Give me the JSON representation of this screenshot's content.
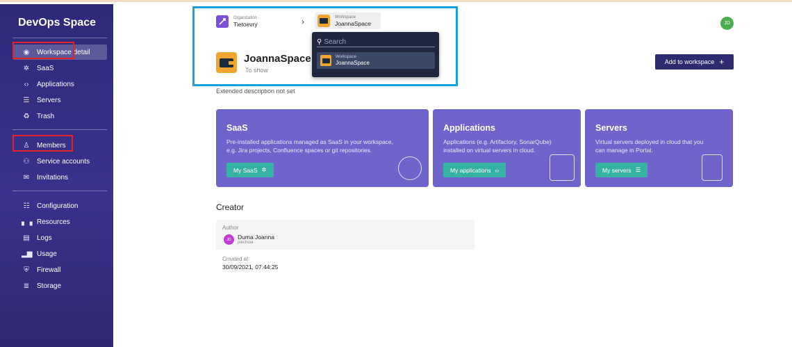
{
  "app": {
    "title": "DevOps Space"
  },
  "sidebar": {
    "items": [
      {
        "label": "Workspace detail",
        "icon": "eye-icon",
        "active": true
      },
      {
        "label": "SaaS",
        "icon": "saas-icon"
      },
      {
        "label": "Applications",
        "icon": "code-icon"
      },
      {
        "label": "Servers",
        "icon": "server-icon"
      },
      {
        "label": "Trash",
        "icon": "trash-icon"
      },
      {
        "label": "Members",
        "icon": "person-icon"
      },
      {
        "label": "Service accounts",
        "icon": "people-icon"
      },
      {
        "label": "Invitations",
        "icon": "mail-icon"
      },
      {
        "label": "Configuration",
        "icon": "sliders-icon"
      },
      {
        "label": "Resources",
        "icon": "bars-icon"
      },
      {
        "label": "Logs",
        "icon": "document-icon"
      },
      {
        "label": "Usage",
        "icon": "chart-icon"
      },
      {
        "label": "Firewall",
        "icon": "shield-icon"
      },
      {
        "label": "Storage",
        "icon": "list-icon"
      }
    ]
  },
  "breadcrumb": {
    "org_caption": "Organization",
    "org_name": "Tietoevry",
    "ws_caption": "Workspace",
    "ws_name": "JoannaSpace"
  },
  "user": {
    "initials": "JD"
  },
  "dropdown": {
    "search_placeholder": "Search",
    "item_caption": "Workspace",
    "item_name": "JoannaSpace"
  },
  "workspace": {
    "title": "JoannaSpace",
    "subtitle": "To show",
    "description": "Extended description not set",
    "add_button": "Add to workspace"
  },
  "cards": [
    {
      "title": "SaaS",
      "line1": "Pre-installed applications managed as SaaS in your workspace,",
      "line2": "e.g. Jira projects, Confluence spaces or git repositories.",
      "button": "My SaaS"
    },
    {
      "title": "Applications",
      "line1": "Applications (e.g. Artifactory, SonarQube)",
      "line2": "installed on virtual servers in cloud.",
      "button": "My applications"
    },
    {
      "title": "Servers",
      "line1": "Virtual servers deployed in cloud that you",
      "line2": "can manage in Portal.",
      "button": "My servers"
    }
  ],
  "creator": {
    "section_title": "Creator",
    "author_label": "Author",
    "author_initials": "JD",
    "author_name": "Duma Joanna",
    "author_login": "piechioa",
    "created_label": "Created at",
    "created_value": "30/09/2021, 07:44:25"
  },
  "colors": {
    "sidebar": "#2c2a78",
    "card": "#6f63cc",
    "card_button": "#35b2a3",
    "primary_button": "#2d2a6e",
    "highlight_red": "#e2232b",
    "highlight_blue": "#1ba0d9"
  }
}
